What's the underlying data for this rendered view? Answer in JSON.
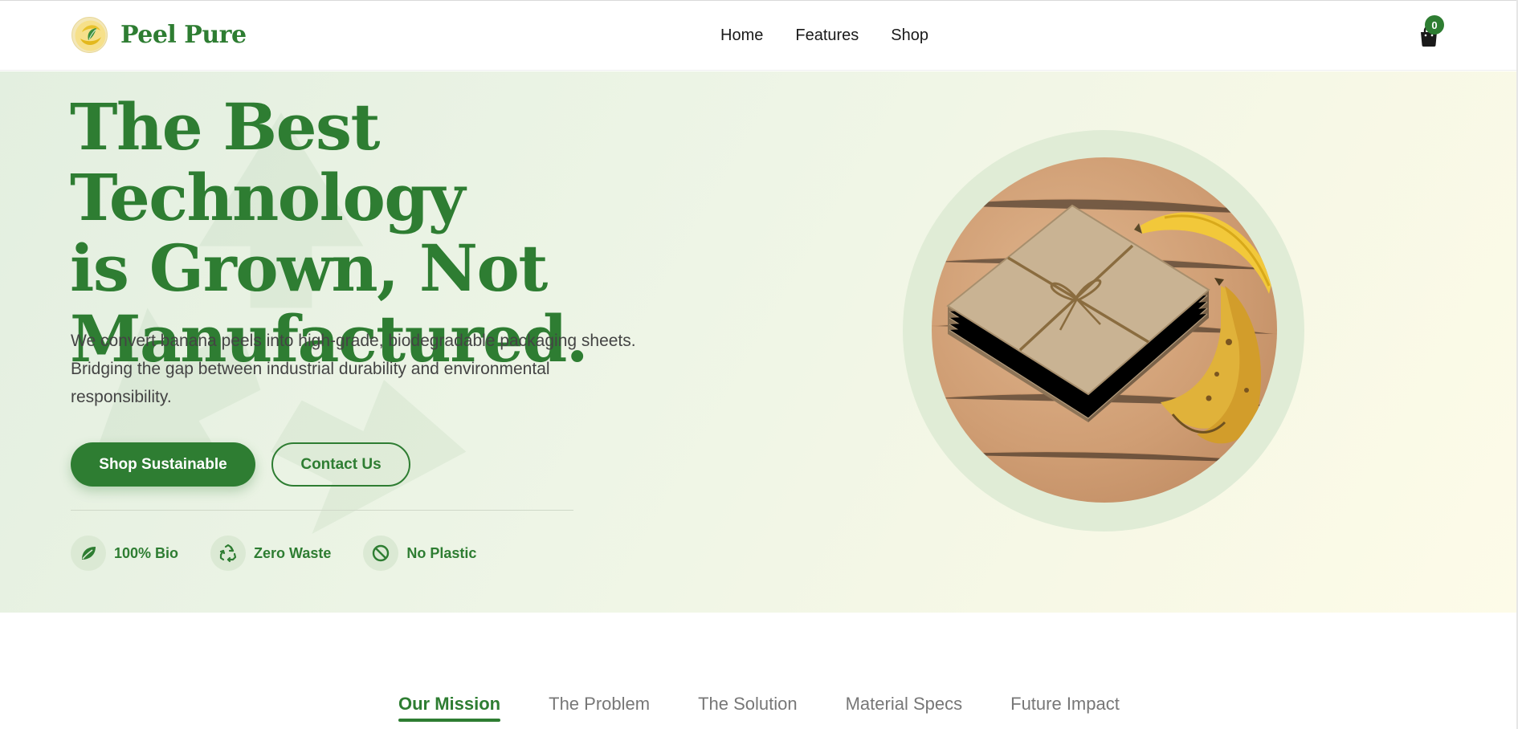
{
  "brand": {
    "name": "Peel Pure",
    "logo_icon": "banana-leaf-logo",
    "accent_color": "#2e7d32"
  },
  "nav": {
    "items": [
      {
        "label": "Home"
      },
      {
        "label": "Features"
      },
      {
        "label": "Shop"
      }
    ]
  },
  "cart": {
    "icon": "shopping-bag-icon",
    "count": "0"
  },
  "hero": {
    "title_lines": [
      "The Best Technology",
      "is Grown, Not",
      "Manufactured."
    ],
    "description_lines": [
      "We convert banana peels into high-grade, biodegradable packaging sheets.",
      "Bridging the gap between industrial durability and environmental",
      "responsibility."
    ],
    "primary_button": "Shop Sustainable",
    "secondary_button": "Contact Us",
    "features": [
      {
        "label": "100% Bio",
        "icon": "leaf-icon"
      },
      {
        "label": "Zero Waste",
        "icon": "recycle-icon"
      },
      {
        "label": "No Plastic",
        "icon": "no-symbol-icon"
      }
    ],
    "image_alt": "Stack of banana-peel paper sheets tied with twine beside banana peels"
  },
  "tabs": [
    {
      "label": "Our Mission",
      "active": true
    },
    {
      "label": "The Problem",
      "active": false
    },
    {
      "label": "The Solution",
      "active": false
    },
    {
      "label": "Material Specs",
      "active": false
    },
    {
      "label": "Future Impact",
      "active": false
    }
  ]
}
